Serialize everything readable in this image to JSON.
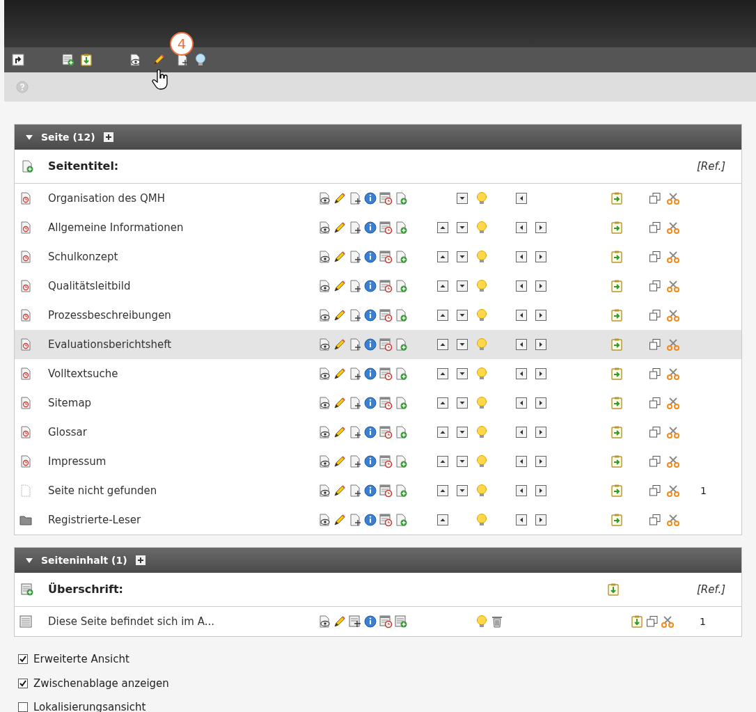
{
  "toolbar": {
    "badge": "4"
  },
  "page_panel": {
    "title": "Seite (12)",
    "header_label": "Seitentitel:",
    "ref_label": "[Ref.]",
    "rows": [
      {
        "title": "Organisation des QMH",
        "kind": "page",
        "selected": false,
        "up": false,
        "down": true,
        "left": true,
        "right": false
      },
      {
        "title": "Allgemeine Informationen",
        "kind": "page",
        "selected": false,
        "up": true,
        "down": true,
        "left": true,
        "right": true
      },
      {
        "title": "Schulkonzept",
        "kind": "page",
        "selected": false,
        "up": true,
        "down": true,
        "left": true,
        "right": true
      },
      {
        "title": "Qualitätsleitbild",
        "kind": "page",
        "selected": false,
        "up": true,
        "down": true,
        "left": true,
        "right": true
      },
      {
        "title": "Prozessbeschreibungen",
        "kind": "page",
        "selected": false,
        "up": true,
        "down": true,
        "left": true,
        "right": true
      },
      {
        "title": "Evaluationsberichtsheft",
        "kind": "page",
        "selected": true,
        "up": true,
        "down": true,
        "left": true,
        "right": true
      },
      {
        "title": "Volltextsuche",
        "kind": "page",
        "selected": false,
        "up": true,
        "down": true,
        "left": true,
        "right": true
      },
      {
        "title": "Sitemap",
        "kind": "page",
        "selected": false,
        "up": true,
        "down": true,
        "left": true,
        "right": true
      },
      {
        "title": "Glossar",
        "kind": "page",
        "selected": false,
        "up": true,
        "down": true,
        "left": true,
        "right": true
      },
      {
        "title": "Impressum",
        "kind": "page",
        "selected": false,
        "up": true,
        "down": true,
        "left": true,
        "right": true
      },
      {
        "title": "Seite nicht gefunden",
        "kind": "blank",
        "selected": false,
        "up": true,
        "down": true,
        "left": true,
        "right": true,
        "count": "1"
      },
      {
        "title": "Registrierte-Leser",
        "kind": "folder",
        "selected": false,
        "up": true,
        "down": false,
        "left": true,
        "right": true
      }
    ]
  },
  "content_panel": {
    "title": "Seiteninhalt (1)",
    "header_label": "Überschrift:",
    "ref_label": "[Ref.]",
    "rows": [
      {
        "title": "Diese Seite befindet sich im A...",
        "count": "1"
      }
    ]
  },
  "options": [
    {
      "label": "Erweiterte Ansicht",
      "checked": true
    },
    {
      "label": "Zwischenablage anzeigen",
      "checked": true
    },
    {
      "label": "Lokalisierungsansicht",
      "checked": false
    }
  ]
}
